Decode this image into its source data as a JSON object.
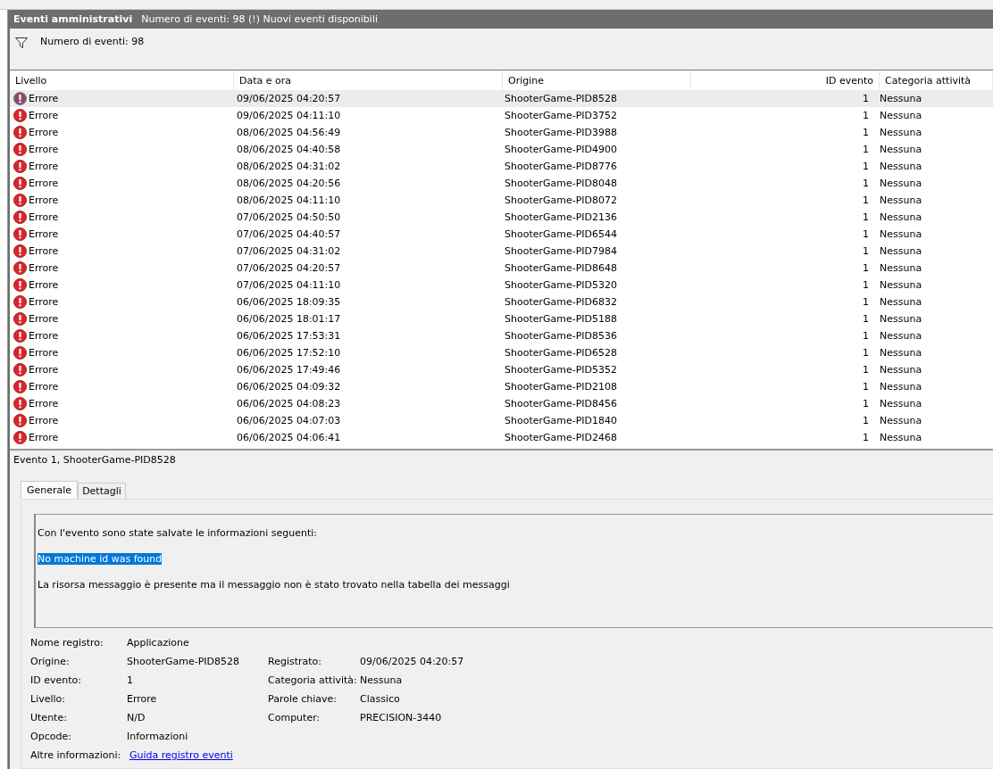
{
  "header": {
    "title": "Eventi amministrativi",
    "subtitle": "Numero di eventi: 98 (!) Nuovi eventi disponibili"
  },
  "filter": {
    "label": "Numero di eventi: 98"
  },
  "table": {
    "columns": [
      "Livello",
      "Data e ora",
      "Origine",
      "ID evento",
      "Categoria attività"
    ],
    "rows": [
      {
        "level": "Errore",
        "date": "09/06/2025 04:20:57",
        "source": "ShooterGame-PID8528",
        "id": "1",
        "category": "Nessuna",
        "selected": true
      },
      {
        "level": "Errore",
        "date": "09/06/2025 04:11:10",
        "source": "ShooterGame-PID3752",
        "id": "1",
        "category": "Nessuna",
        "selected": false
      },
      {
        "level": "Errore",
        "date": "08/06/2025 04:56:49",
        "source": "ShooterGame-PID3988",
        "id": "1",
        "category": "Nessuna",
        "selected": false
      },
      {
        "level": "Errore",
        "date": "08/06/2025 04:40:58",
        "source": "ShooterGame-PID4900",
        "id": "1",
        "category": "Nessuna",
        "selected": false
      },
      {
        "level": "Errore",
        "date": "08/06/2025 04:31:02",
        "source": "ShooterGame-PID8776",
        "id": "1",
        "category": "Nessuna",
        "selected": false
      },
      {
        "level": "Errore",
        "date": "08/06/2025 04:20:56",
        "source": "ShooterGame-PID8048",
        "id": "1",
        "category": "Nessuna",
        "selected": false
      },
      {
        "level": "Errore",
        "date": "08/06/2025 04:11:10",
        "source": "ShooterGame-PID8072",
        "id": "1",
        "category": "Nessuna",
        "selected": false
      },
      {
        "level": "Errore",
        "date": "07/06/2025 04:50:50",
        "source": "ShooterGame-PID2136",
        "id": "1",
        "category": "Nessuna",
        "selected": false
      },
      {
        "level": "Errore",
        "date": "07/06/2025 04:40:57",
        "source": "ShooterGame-PID6544",
        "id": "1",
        "category": "Nessuna",
        "selected": false
      },
      {
        "level": "Errore",
        "date": "07/06/2025 04:31:02",
        "source": "ShooterGame-PID7984",
        "id": "1",
        "category": "Nessuna",
        "selected": false
      },
      {
        "level": "Errore",
        "date": "07/06/2025 04:20:57",
        "source": "ShooterGame-PID8648",
        "id": "1",
        "category": "Nessuna",
        "selected": false
      },
      {
        "level": "Errore",
        "date": "07/06/2025 04:11:10",
        "source": "ShooterGame-PID5320",
        "id": "1",
        "category": "Nessuna",
        "selected": false
      },
      {
        "level": "Errore",
        "date": "06/06/2025 18:09:35",
        "source": "ShooterGame-PID6832",
        "id": "1",
        "category": "Nessuna",
        "selected": false
      },
      {
        "level": "Errore",
        "date": "06/06/2025 18:01:17",
        "source": "ShooterGame-PID5188",
        "id": "1",
        "category": "Nessuna",
        "selected": false
      },
      {
        "level": "Errore",
        "date": "06/06/2025 17:53:31",
        "source": "ShooterGame-PID8536",
        "id": "1",
        "category": "Nessuna",
        "selected": false
      },
      {
        "level": "Errore",
        "date": "06/06/2025 17:52:10",
        "source": "ShooterGame-PID6528",
        "id": "1",
        "category": "Nessuna",
        "selected": false
      },
      {
        "level": "Errore",
        "date": "06/06/2025 17:49:46",
        "source": "ShooterGame-PID5352",
        "id": "1",
        "category": "Nessuna",
        "selected": false
      },
      {
        "level": "Errore",
        "date": "06/06/2025 04:09:32",
        "source": "ShooterGame-PID2108",
        "id": "1",
        "category": "Nessuna",
        "selected": false
      },
      {
        "level": "Errore",
        "date": "06/06/2025 04:08:23",
        "source": "ShooterGame-PID8456",
        "id": "1",
        "category": "Nessuna",
        "selected": false
      },
      {
        "level": "Errore",
        "date": "06/06/2025 04:07:03",
        "source": "ShooterGame-PID1840",
        "id": "1",
        "category": "Nessuna",
        "selected": false
      },
      {
        "level": "Errore",
        "date": "06/06/2025 04:06:41",
        "source": "ShooterGame-PID2468",
        "id": "1",
        "category": "Nessuna",
        "selected": false
      }
    ]
  },
  "details": {
    "title": "Evento 1, ShooterGame-PID8528",
    "tabs": [
      {
        "label": "Generale",
        "selected": true
      },
      {
        "label": "Dettagli",
        "selected": false
      }
    ],
    "message": [
      {
        "text": "Con l'evento sono state salvate le informazioni seguenti:",
        "highlighted": false
      },
      {
        "text": "No machine id was found",
        "highlighted": true
      },
      {
        "text": "La risorsa messaggio è presente ma il messaggio non è stato trovato nella tabella dei messaggi",
        "highlighted": false
      }
    ],
    "properties": [
      {
        "label": "Nome registro:",
        "value": "Applicazione"
      },
      {
        "label": "Origine:",
        "value": "ShooterGame-PID8528",
        "label2": "Registrato:",
        "value2": "09/06/2025 04:20:57"
      },
      {
        "label": "ID evento:",
        "value": "1",
        "label2": "Categoria attività:",
        "value2": "Nessuna"
      },
      {
        "label": "Livello:",
        "value": "Errore",
        "label2": "Parole chiave:",
        "value2": "Classico"
      },
      {
        "label": "Utente:",
        "value": "N/D",
        "label2": "Computer:",
        "value2": "PRECISION-3440"
      },
      {
        "label": "Opcode:",
        "value": "Informazioni"
      },
      {
        "label": "Altre informazioni:",
        "value": "Guida registro eventi",
        "kind": "link"
      }
    ]
  }
}
